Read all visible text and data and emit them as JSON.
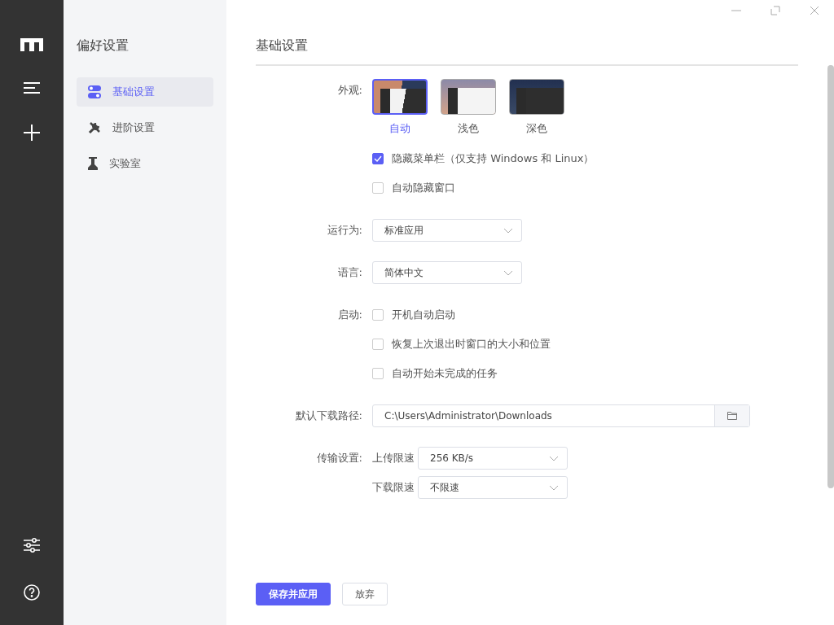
{
  "sidebar": {
    "title": "偏好设置",
    "items": [
      {
        "label": "基础设置",
        "kind": "toggles",
        "selected": true
      },
      {
        "label": "进阶设置",
        "kind": "tools",
        "selected": false
      },
      {
        "label": "实验室",
        "kind": "flask",
        "selected": false
      }
    ]
  },
  "main": {
    "title": "基础设置",
    "settings": [
      {
        "kind": "appearance",
        "label": "外观:",
        "themes": [
          {
            "label": "自动",
            "kind": "auto",
            "selected": true
          },
          {
            "label": "浅色",
            "kind": "light",
            "selected": false
          },
          {
            "label": "深色",
            "kind": "dark",
            "selected": false
          }
        ],
        "options": [
          {
            "label": "隐藏菜单栏（仅支持 Windows 和 Linux）",
            "checked": true
          },
          {
            "label": "自动隐藏窗口",
            "checked": false
          }
        ]
      },
      {
        "kind": "select",
        "label": "运行为:",
        "value": "标准应用"
      },
      {
        "kind": "select",
        "label": "语言:",
        "value": "简体中文"
      },
      {
        "kind": "checks",
        "label": "启动:",
        "options": [
          {
            "label": "开机自动启动",
            "checked": false
          },
          {
            "label": "恢复上次退出时窗口的大小和位置",
            "checked": false
          },
          {
            "label": "自动开始未完成的任务",
            "checked": false
          }
        ]
      },
      {
        "kind": "path",
        "label": "默认下载路径:",
        "value": "C:\\Users\\Administrator\\Downloads"
      },
      {
        "kind": "transfer",
        "label": "传输设置:",
        "limits": [
          {
            "label": "上传限速",
            "value": "256 KB/s"
          },
          {
            "label": "下载限速",
            "value": "不限速"
          }
        ]
      }
    ]
  },
  "footer": {
    "buttons": [
      {
        "label": "保存并应用",
        "primary": true
      },
      {
        "label": "放弃",
        "primary": false
      }
    ]
  }
}
